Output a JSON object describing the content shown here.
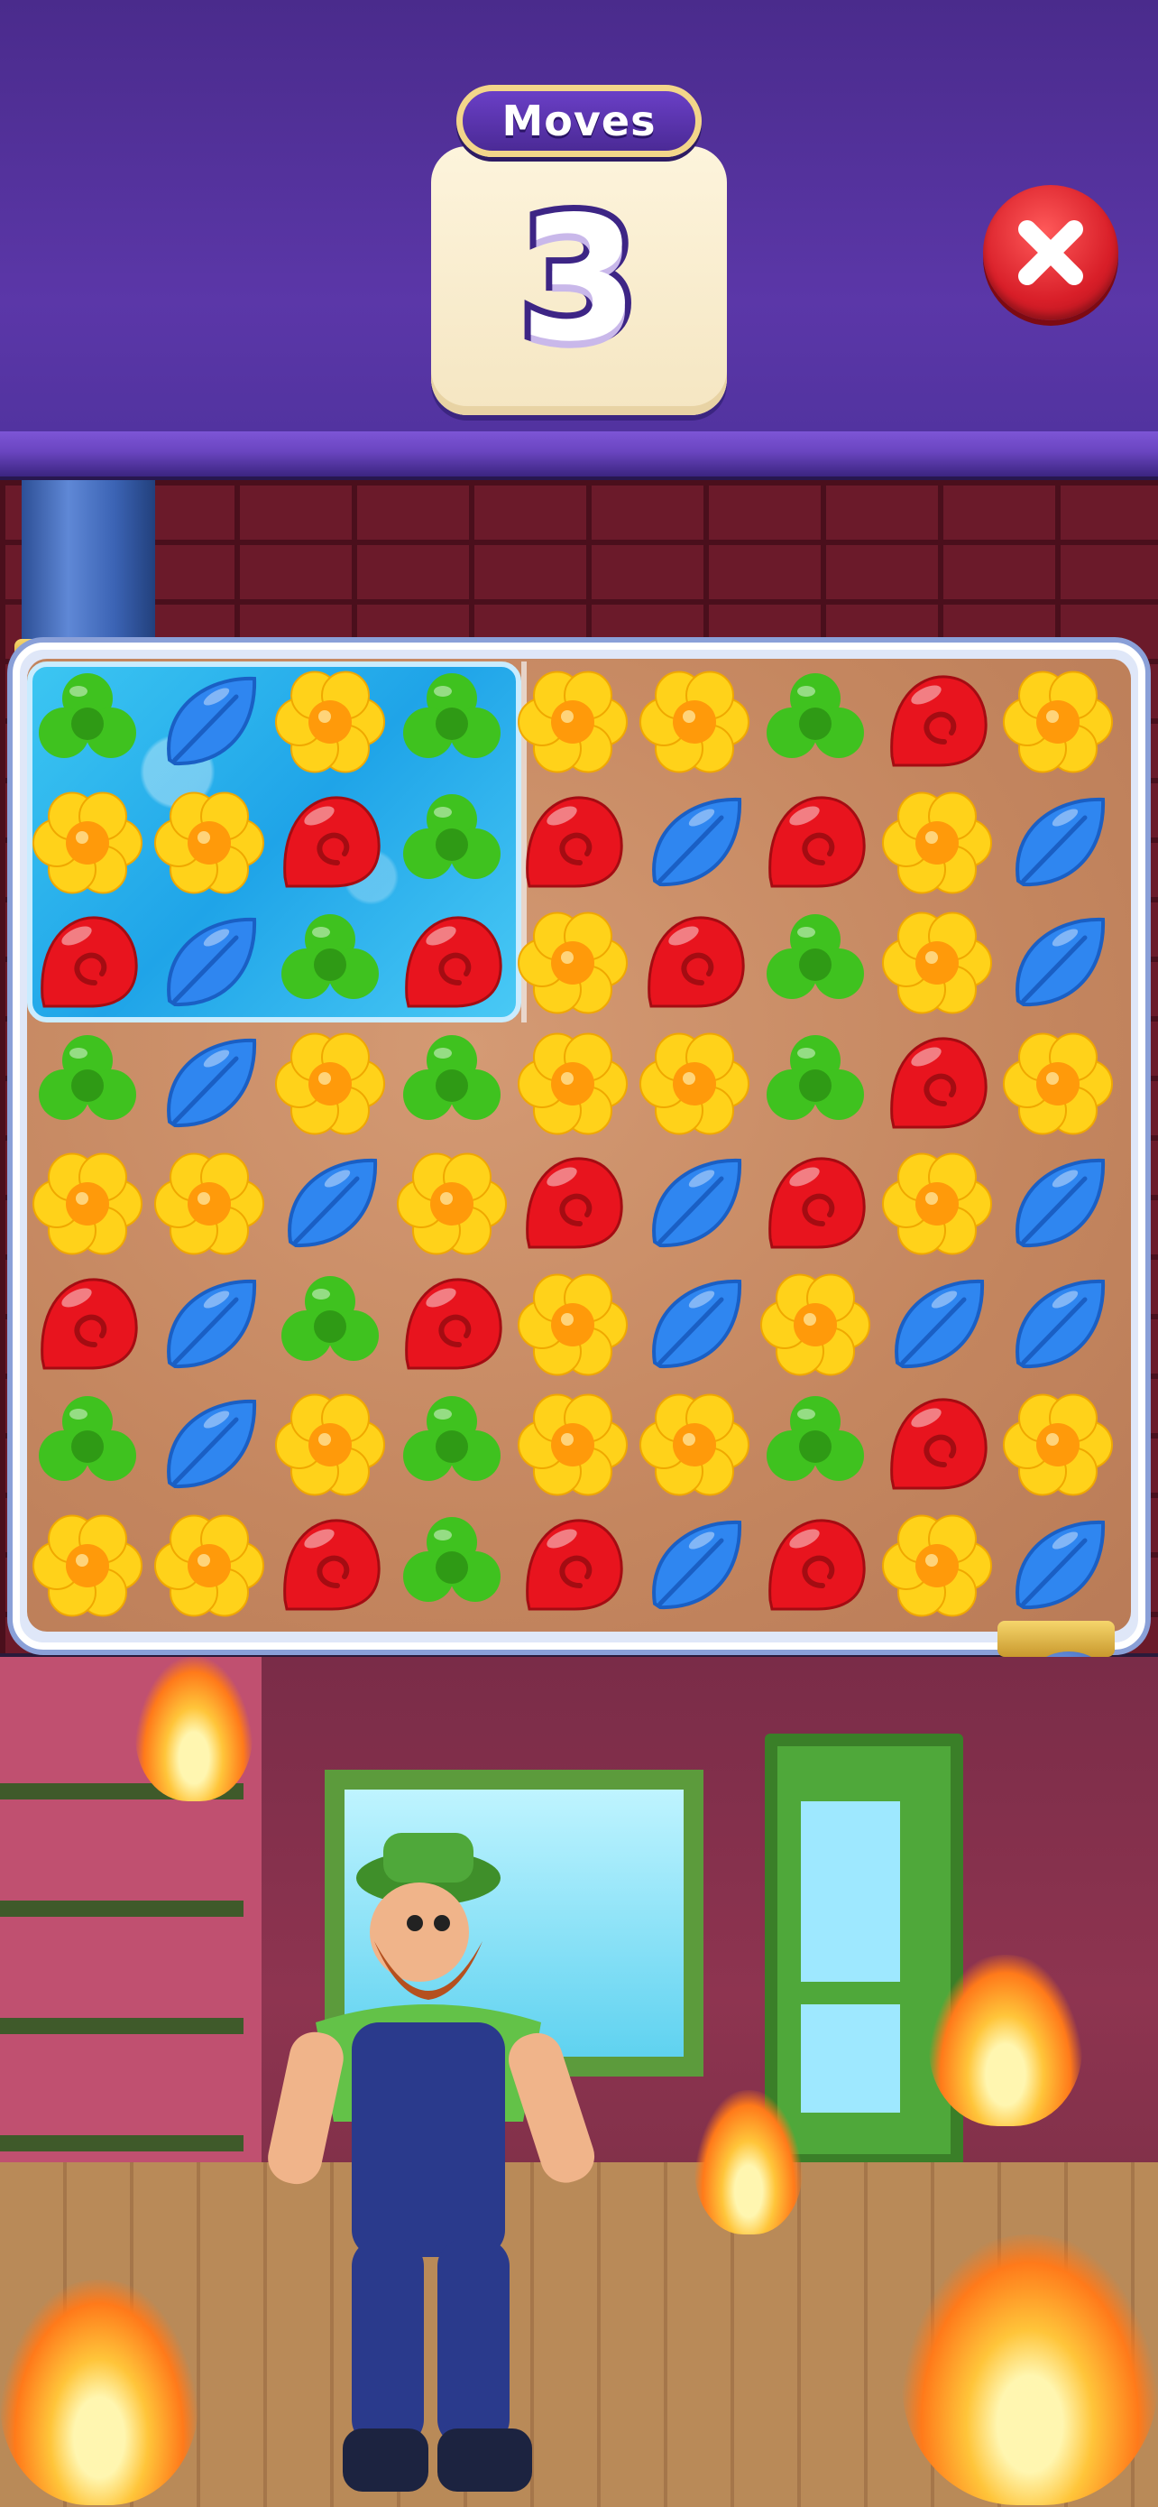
{
  "header": {
    "moves_label": "Moves",
    "moves_count": "3"
  },
  "board": {
    "rows": 8,
    "cols": 9,
    "grid": [
      [
        "clover",
        "leaf",
        "flower",
        "clover",
        "flower",
        "flower",
        "clover",
        "shell",
        "flower"
      ],
      [
        "flower",
        "flower",
        "shell",
        "clover",
        "shell",
        "leaf",
        "shell",
        "flower",
        "leaf"
      ],
      [
        "shell",
        "leaf",
        "clover",
        "shell",
        "flower",
        "shell",
        "clover",
        "flower",
        "leaf"
      ],
      [
        "clover",
        "leaf",
        "flower",
        "clover",
        "flower",
        "flower",
        "clover",
        "shell",
        "flower"
      ],
      [
        "flower",
        "flower",
        "leaf",
        "flower",
        "shell",
        "leaf",
        "shell",
        "flower",
        "leaf"
      ],
      [
        "shell",
        "leaf",
        "clover",
        "shell",
        "flower",
        "leaf",
        "flower",
        "leaf",
        "leaf"
      ],
      [
        "clover",
        "leaf",
        "flower",
        "clover",
        "flower",
        "flower",
        "clover",
        "shell",
        "flower"
      ],
      [
        "flower",
        "flower",
        "shell",
        "clover",
        "shell",
        "leaf",
        "shell",
        "flower",
        "leaf"
      ]
    ],
    "water_zone": {
      "rows": 3,
      "cols": 4
    }
  },
  "colors": {
    "header_purple": "#5b37a8",
    "clover": "#3fc21f",
    "leaf": "#2f86f0",
    "flower_petal": "#ffd21a",
    "flower_center": "#ff9a0a",
    "shell": "#e8141e",
    "close_button": "#d81e28"
  },
  "icons": {
    "close": "close-x-icon",
    "tiles": [
      "clover-icon",
      "leaf-icon",
      "flower-icon",
      "shell-icon"
    ]
  }
}
